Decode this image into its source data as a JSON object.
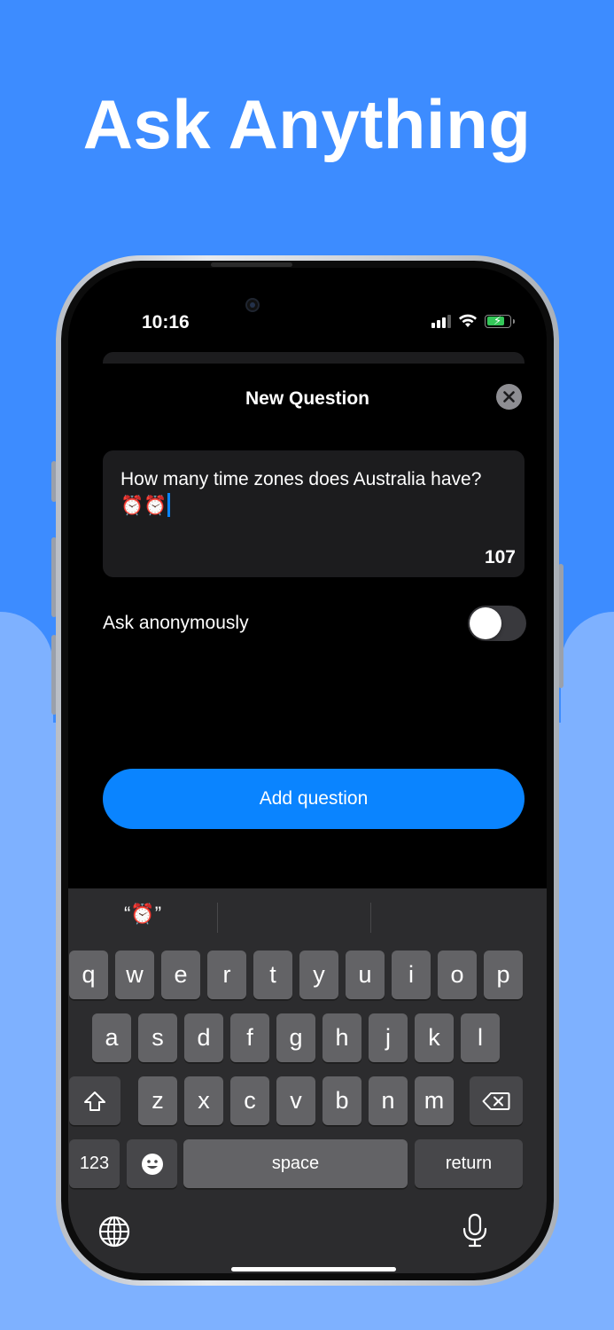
{
  "hero": {
    "title": "Ask Anything"
  },
  "status_bar": {
    "time": "10:16",
    "icons": [
      "cellular-signal-icon",
      "wifi-icon",
      "battery-charging-icon"
    ]
  },
  "sheet": {
    "title": "New Question",
    "close_icon": "close-icon"
  },
  "question": {
    "text": "How many time zones does Australia have? ⏰⏰",
    "char_count": "107"
  },
  "anonymous": {
    "label": "Ask anonymously",
    "enabled": false
  },
  "add_button": {
    "label": "Add question"
  },
  "keyboard": {
    "suggestions": [
      "“⏰”",
      "",
      ""
    ],
    "row1": [
      "q",
      "w",
      "e",
      "r",
      "t",
      "y",
      "u",
      "i",
      "o",
      "p"
    ],
    "row2": [
      "a",
      "s",
      "d",
      "f",
      "g",
      "h",
      "j",
      "k",
      "l"
    ],
    "row3": [
      "z",
      "x",
      "c",
      "v",
      "b",
      "n",
      "m"
    ],
    "numbers_label": "123",
    "space_label": "space",
    "return_label": "return"
  },
  "colors": {
    "background_top": "#3d8cff",
    "background_bottom": "#7eb1ff",
    "accent": "#0a84ff"
  }
}
